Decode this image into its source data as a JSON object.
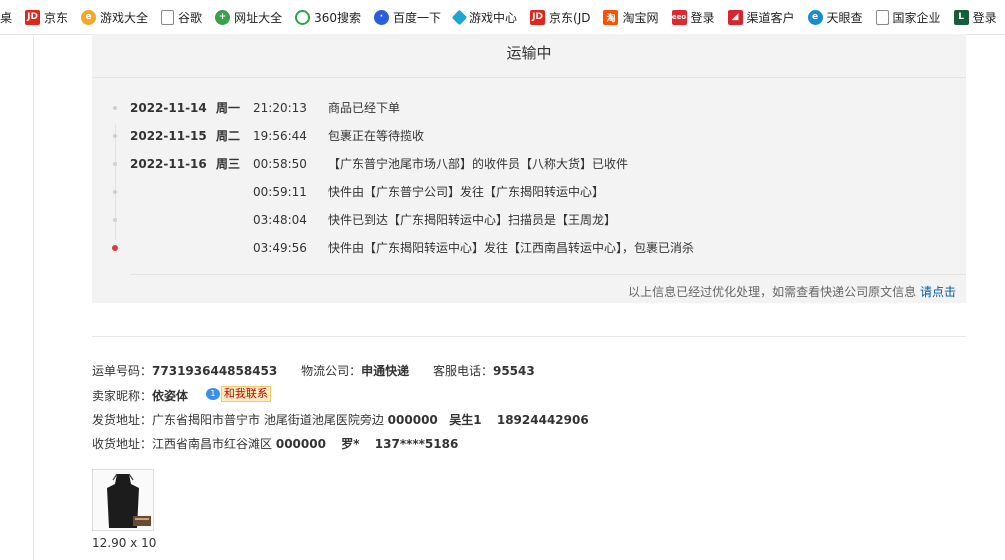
{
  "bookmarks": [
    {
      "label": "桌",
      "icon": "none-partial"
    },
    {
      "label": "京东",
      "icon": "jd-icon"
    },
    {
      "label": "游戏大全",
      "icon": "game-icon"
    },
    {
      "label": "谷歌",
      "icon": "document-icon"
    },
    {
      "label": "网址大全",
      "icon": "plus-circle-icon"
    },
    {
      "label": "360搜索",
      "icon": "360-search-icon"
    },
    {
      "label": "百度一下",
      "icon": "baidu-paw-icon"
    },
    {
      "label": "游戏中心",
      "icon": "game-center-icon"
    },
    {
      "label": "京东(JD",
      "icon": "jd-icon"
    },
    {
      "label": "淘宝网",
      "icon": "taobao-icon"
    },
    {
      "label": "登录",
      "icon": "login-icon"
    },
    {
      "label": "渠道客户",
      "icon": "channel-icon"
    },
    {
      "label": "天眼查",
      "icon": "tianyancha-icon"
    },
    {
      "label": "国家企业",
      "icon": "document-icon"
    },
    {
      "label": "登录",
      "icon": "l-logo-icon"
    }
  ],
  "tracking": {
    "status": "运输中",
    "events": [
      {
        "date": "2022-11-14",
        "weekday": "周一",
        "time": "21:20:13",
        "text": "商品已经下单"
      },
      {
        "date": "2022-11-15",
        "weekday": "周二",
        "time": "19:56:44",
        "text": "包裹正在等待揽收"
      },
      {
        "date": "2022-11-16",
        "weekday": "周三",
        "time": "00:58:50",
        "text": "【广东普宁池尾市场八部】的收件员【八称大货】已收件"
      },
      {
        "date": "",
        "weekday": "",
        "time": "00:59:11",
        "text": "快件由【广东普宁公司】发往【广东揭阳转运中心】"
      },
      {
        "date": "",
        "weekday": "",
        "time": "03:48:04",
        "text": "快件已到达【广东揭阳转运中心】扫描员是【王周龙】"
      },
      {
        "date": "",
        "weekday": "",
        "time": "03:49:56",
        "text": "快件由【广东揭阳转运中心】发往【江西南昌转运中心】，包裹已消杀"
      }
    ],
    "note": "以上信息已经过优化处理，如需查看快递公司原文信息",
    "note_link": "请点击"
  },
  "order": {
    "tracking_no_label": "运单号码：",
    "tracking_no": "773193644858453",
    "carrier_label": "物流公司：",
    "carrier": "申通快递",
    "service_label": "客服电话：",
    "service_phone": "95543",
    "seller_label": "卖家昵称：",
    "seller": "依姿体",
    "contact_label": "和我联系",
    "contact_badge": "1",
    "from_label": "发货地址：",
    "from_address": "广东省揭阳市普宁市 池尾街道池尾医院旁边",
    "from_zip": "000000",
    "from_name": "吴生1",
    "from_phone": "18924442906",
    "to_label": "收货地址：",
    "to_address": "江西省南昌市红谷滩区",
    "to_zip": "000000",
    "to_name": "罗*",
    "to_phone": "137****5186"
  },
  "product": {
    "size": "12.90 x 10"
  },
  "colors": {
    "panel_bg": "#f3f3f3",
    "current_dot": "#e4393c",
    "link": "#005aa0"
  }
}
